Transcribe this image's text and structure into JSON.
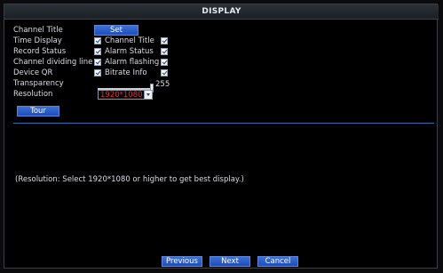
{
  "window": {
    "title": "DISPLAY"
  },
  "rows": {
    "channel_title_label": "Channel Title",
    "set_button": "Set",
    "time_display": "Time Display",
    "channel_title_check": "Channel Title",
    "record_status": "Record Status",
    "alarm_status": "Alarm Status",
    "channel_dividing_line": "Channel dividing line",
    "alarm_flashing": "Alarm flashing",
    "device_qr": "Device QR",
    "bitrate_info": "Bitrate Info",
    "transparency_label": "Transparency",
    "transparency_value": "255",
    "resolution_label": "Resolution",
    "resolution_value": "1920*1080",
    "tour_button": "Tour"
  },
  "note": "(Resolution: Select 1920*1080 or higher to get best display.)",
  "footer": {
    "previous": "Previous",
    "next": "Next",
    "cancel": "Cancel"
  },
  "colors": {
    "accent": "#2a5cc8",
    "resolution_text": "#e03030",
    "divider": "#2f6fae"
  }
}
